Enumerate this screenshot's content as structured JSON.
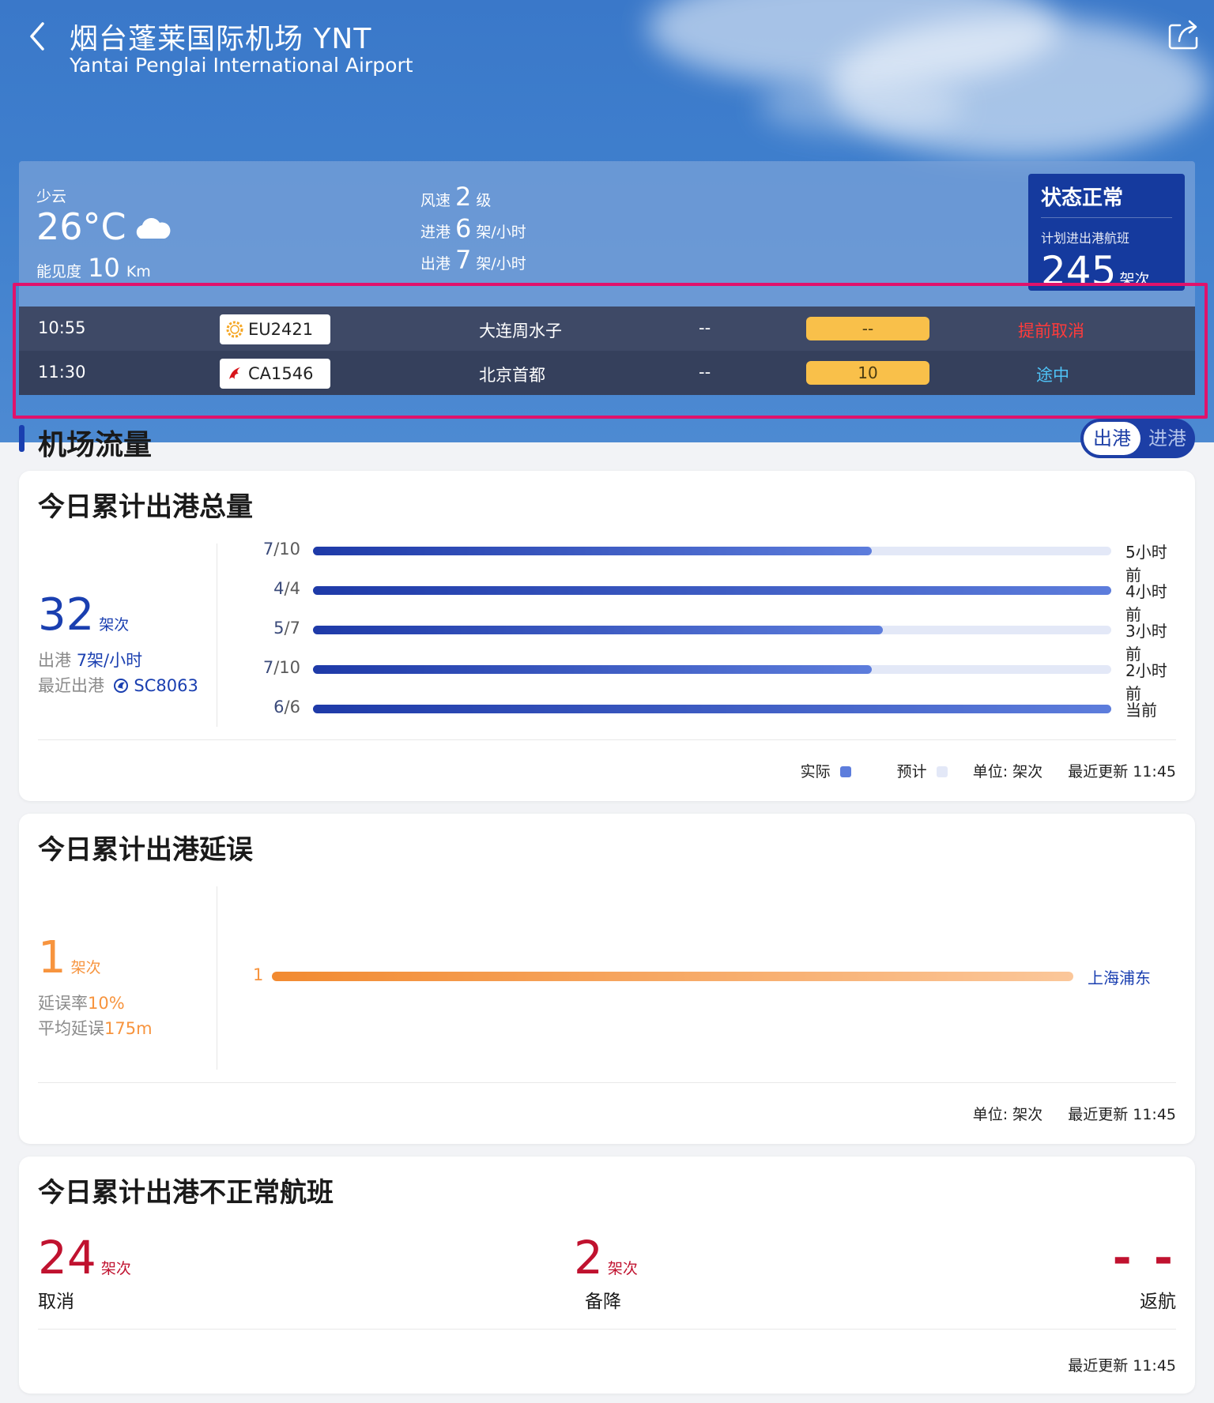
{
  "header": {
    "title": "烟台蓬莱国际机场 YNT",
    "subtitle": "Yantai Penglai International Airport"
  },
  "weather": {
    "condition": "少云",
    "temperature": "26°C",
    "visibility_label": "能见度",
    "visibility_value": "10",
    "visibility_unit": "Km",
    "wind_label": "风速",
    "wind_value": "2",
    "wind_unit": "级",
    "arrive_label": "进港",
    "arrive_value": "6",
    "arrive_unit": "架/小时",
    "depart_label": "出港",
    "depart_value": "7",
    "depart_unit": "架/小时"
  },
  "status": {
    "title": "状态正常",
    "subtitle": "计划进出港航班",
    "count": "245",
    "unit": "架次"
  },
  "flights": [
    {
      "time": "10:55",
      "flight_no": "EU2421",
      "destination": "大连周水子",
      "gate": "--",
      "pill": "--",
      "status": "提前取消",
      "status_color": "#ff3b3b"
    },
    {
      "time": "11:30",
      "flight_no": "CA1546",
      "destination": "北京首都",
      "gate": "--",
      "pill": "10",
      "status": "途中",
      "status_color": "#4fc3f7"
    }
  ],
  "traffic": {
    "section_title": "机场流量",
    "toggle_active": "出港",
    "toggle_inactive": "进港"
  },
  "total_card": {
    "title": "今日累计出港总量",
    "count": "32",
    "unit": "架次",
    "rate_label": "出港",
    "rate_value": "7架/小时",
    "recent_label": "最近出港",
    "recent_flight": "SC8063",
    "bars": [
      {
        "actual": "7",
        "planned": "10",
        "time": "5小时前",
        "ratio": 0.7
      },
      {
        "actual": "4",
        "planned": "4",
        "time": "4小时前",
        "ratio": 1.0
      },
      {
        "actual": "5",
        "planned": "7",
        "time": "3小时前",
        "ratio": 0.714
      },
      {
        "actual": "7",
        "planned": "10",
        "time": "2小时前",
        "ratio": 0.7
      },
      {
        "actual": "6",
        "planned": "6",
        "time": "当前",
        "ratio": 1.0
      }
    ],
    "legend_actual": "实际",
    "legend_planned": "预计",
    "unit_note": "单位: 架次",
    "updated": "最近更新 11:45",
    "color_actual": "#5d7ddc",
    "color_planned": "#e3e8f7"
  },
  "delay_card": {
    "title": "今日累计出港延误",
    "count": "1",
    "unit": "架次",
    "rate_label": "延误率",
    "rate_value": "10%",
    "avg_label": "平均延误",
    "avg_value": "175m",
    "bar_value": "1",
    "bar_dest": "上海浦东",
    "unit_note": "单位: 架次",
    "updated": "最近更新 11:45",
    "color": "#f7943e"
  },
  "abnormal_card": {
    "title": "今日累计出港不正常航班",
    "cancel_count": "24",
    "cancel_unit": "架次",
    "cancel_label": "取消",
    "divert_count": "2",
    "divert_unit": "架次",
    "divert_label": "备降",
    "return_count": "- -",
    "return_label": "返航",
    "updated": "最近更新 11:45"
  }
}
